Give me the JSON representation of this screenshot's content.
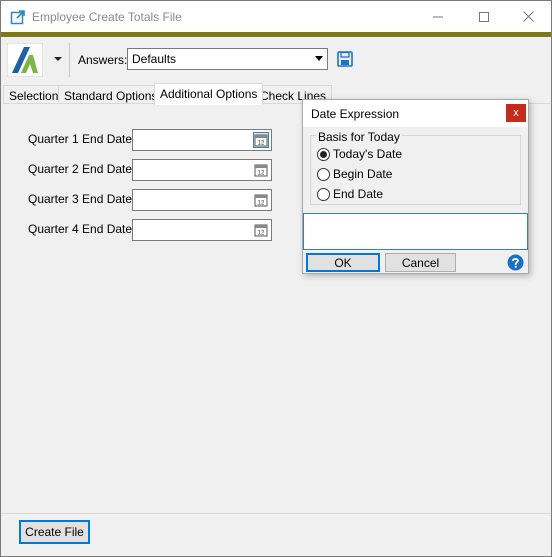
{
  "window": {
    "title": "Employee Create Totals File",
    "controls": {
      "minimize": "minimize-icon",
      "maximize": "maximize-icon",
      "close": "close-icon"
    }
  },
  "toolbar": {
    "answers_label": "Answers:",
    "answers_value": "Defaults"
  },
  "tabs": [
    {
      "label": "Selection"
    },
    {
      "label": "Standard Options"
    },
    {
      "label": "Additional Options"
    },
    {
      "label": "Check Lines"
    }
  ],
  "fields": [
    {
      "label": "Quarter 1 End Date:",
      "value": ""
    },
    {
      "label": "Quarter 2 End Date:",
      "value": ""
    },
    {
      "label": "Quarter 3 End Date:",
      "value": ""
    },
    {
      "label": "Quarter 4 End Date:",
      "value": ""
    }
  ],
  "footer": {
    "create_label": "Create File"
  },
  "dialog": {
    "title": "Date Expression",
    "close_label": "x",
    "group_label": "Basis for Today",
    "options": [
      {
        "label": "Today's Date",
        "selected": true
      },
      {
        "label": "Begin Date",
        "selected": false
      },
      {
        "label": "End Date",
        "selected": false
      }
    ],
    "expression_value": "",
    "ok_label": "OK",
    "cancel_label": "Cancel"
  },
  "colors": {
    "accent_bar": "#7f7a19",
    "focus_blue": "#0078d7",
    "close_red": "#c42b1c",
    "logo_blue": "#1f5fa8",
    "logo_green": "#7ab648"
  }
}
